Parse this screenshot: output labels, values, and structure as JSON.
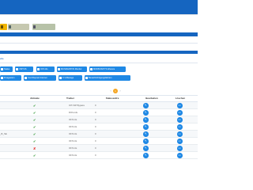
{
  "toolbar": {
    "buttons": [
      {
        "label": ""
      },
      {
        "label": ""
      },
      {
        "label": ""
      }
    ]
  },
  "section": {
    "label": "elle"
  },
  "chips": [
    {
      "label": "Status"
    },
    {
      "label": "VIRTUS"
    },
    {
      "label": "OFS Ids"
    },
    {
      "label": "MUSIKEXPOS Monitor"
    },
    {
      "label": "MODBUS/PYS Alhance"
    },
    {
      "label": "Finagestion"
    },
    {
      "label": "Conf.Deposit Internet"
    },
    {
      "label": "C.V.Manage"
    },
    {
      "label": "Benachrichtigungsfahrten"
    }
  ],
  "pager": {
    "page": "1"
  },
  "table": {
    "headers": [
      "",
      "Aktivate",
      "Treiber",
      "Statusanfra",
      "Bearbeiten",
      "Löschen"
    ],
    "rows": [
      {
        "name": "",
        "active": "✔",
        "active_ok": true,
        "driver": "IOT-ISP Bypass",
        "status": "0"
      },
      {
        "name": "",
        "active": "✔",
        "active_ok": true,
        "driver": "DOG-Ids",
        "status": "0"
      },
      {
        "name": "",
        "active": "✔",
        "active_ok": true,
        "driver": "OFS Ids",
        "status": "0"
      },
      {
        "name": "",
        "active": "✔",
        "active_ok": true,
        "driver": "OFS Ids",
        "status": "0"
      },
      {
        "name": "_B_SE",
        "active": "✔",
        "active_ok": true,
        "driver": "OFS Ids",
        "status": "0"
      },
      {
        "name": "",
        "active": "✔",
        "active_ok": true,
        "driver": "OFS Ids",
        "status": "0"
      },
      {
        "name": "",
        "active": "✘",
        "active_ok": false,
        "driver": "OFS Ids",
        "status": "0"
      },
      {
        "name": "",
        "active": "✔",
        "active_ok": true,
        "driver": "OFS Ids",
        "status": "0"
      }
    ]
  },
  "icons": {
    "edit": "pencil-icon",
    "delete": "trash-icon"
  },
  "colors": {
    "primary": "#1565c0",
    "accent": "#1e88e5",
    "pager": "#f5a623",
    "ok": "#43a047",
    "error": "#e53935"
  }
}
